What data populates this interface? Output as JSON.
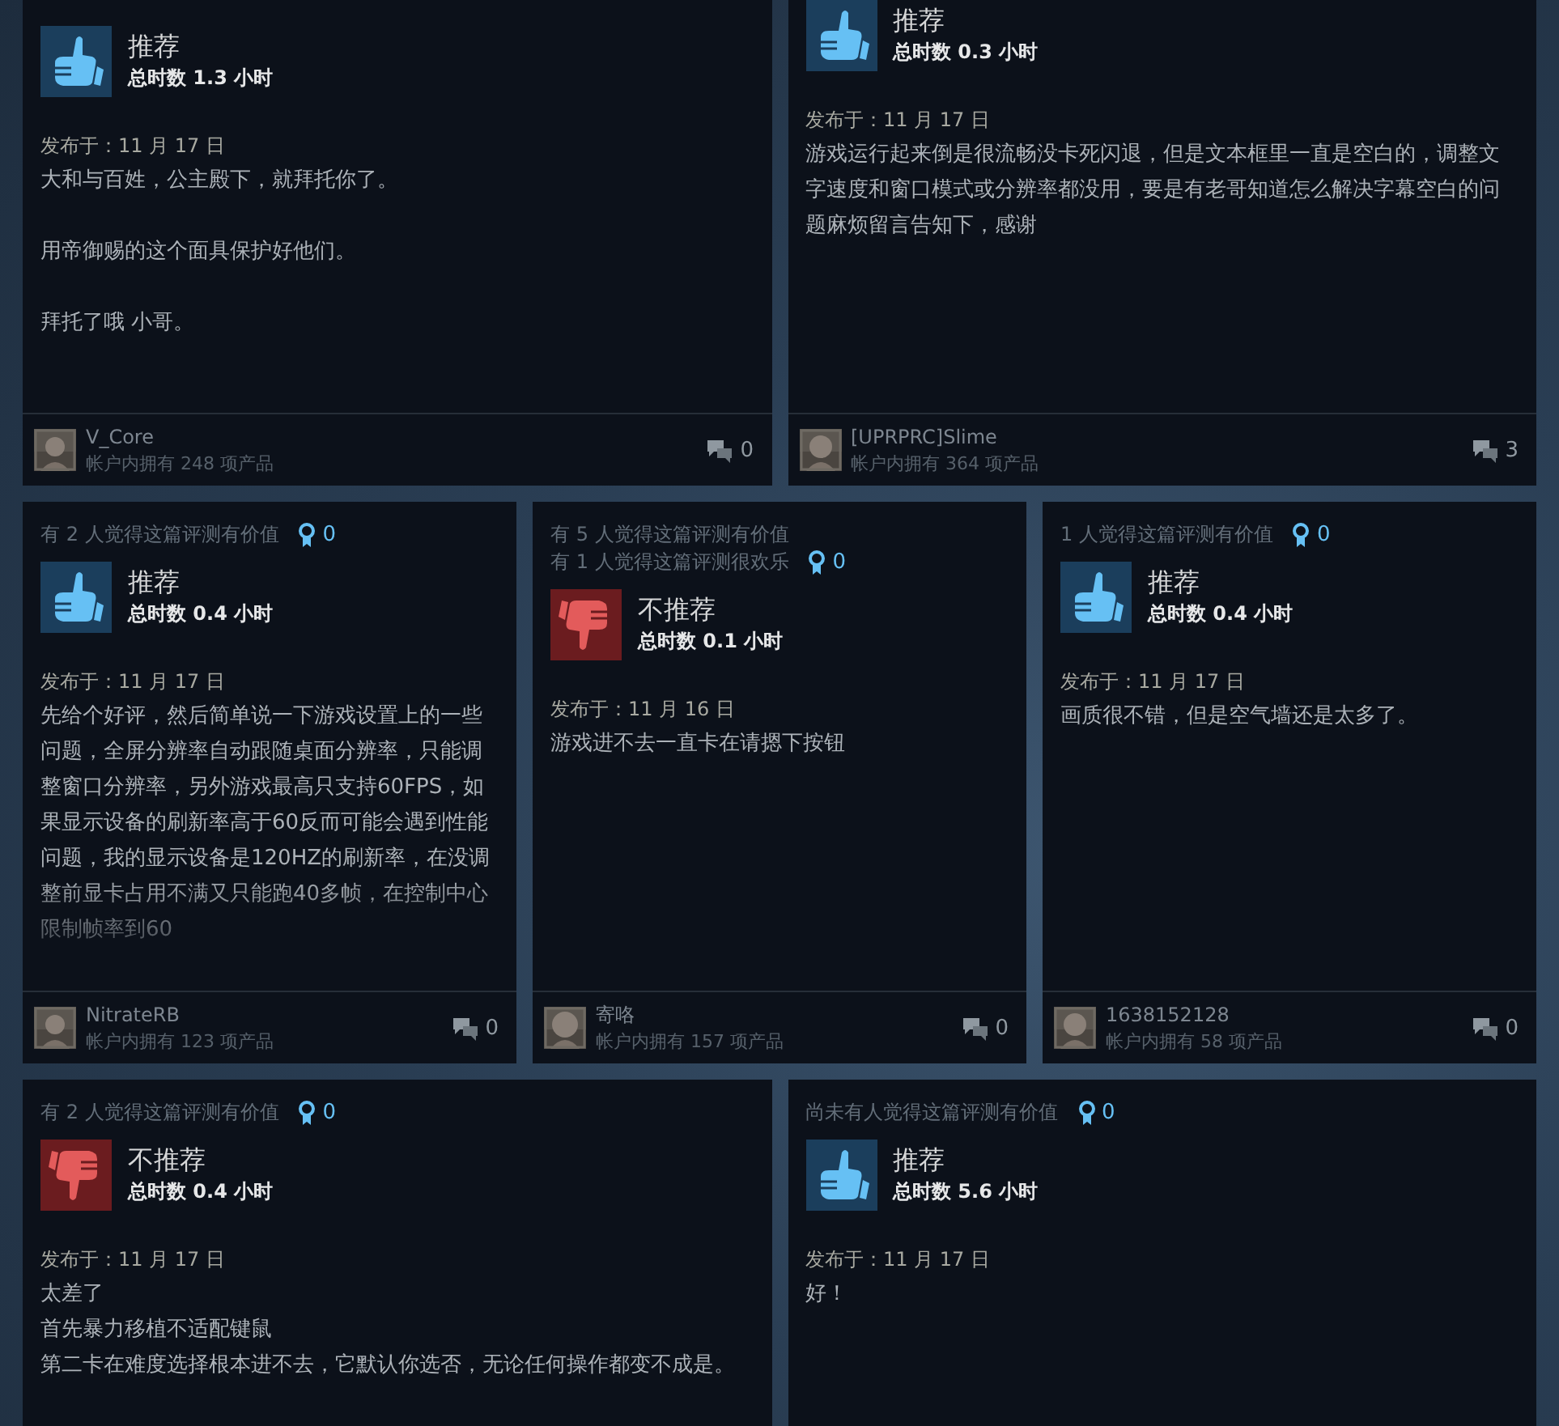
{
  "rows": [
    {
      "reviews": [
        {
          "verdict": {
            "kind": "up",
            "label": "推荐"
          },
          "hours": "总时数 1.3 小时",
          "posted": "发布于：11 月 17 日",
          "body": [
            {
              "kind": "paragraph",
              "text": "大和与百姓，公主殿下，就拜托你了。"
            },
            {
              "kind": "paragraph",
              "text": "用帝御赐的这个面具保护好他们。"
            },
            {
              "kind": "paragraph",
              "text": "拜托了哦 小哥。"
            }
          ],
          "author": "V_Core",
          "products": "帐户内拥有 248 项产品",
          "comments": "0"
        },
        {
          "verdict": {
            "kind": "up",
            "label": "推荐"
          },
          "hours": "总时数 0.3 小时",
          "posted": "发布于：11 月 17 日",
          "body": [
            {
              "kind": "line",
              "text": "游戏运行起来倒是很流畅没卡死闪退，但是文本框里一直是空白的，调整文字速度和窗口模式或分辨率都没用，要是有老哥知道怎么解决字幕空白的问题麻烦留言告知下，感谢"
            }
          ],
          "author": "[UPRPRC]Slime",
          "products": "帐户内拥有 364 项产品",
          "comments": "3"
        }
      ]
    },
    {
      "reviews": [
        {
          "helpful": [
            "有 2 人觉得这篇评测有价值"
          ],
          "award_count": "0",
          "verdict": {
            "kind": "up",
            "label": "推荐"
          },
          "hours": "总时数 0.4 小时",
          "posted": "发布于：11 月 17 日",
          "truncated": true,
          "body": [
            {
              "kind": "line",
              "text": "先给个好评，然后简单说一下游戏设置上的一些问题，全屏分辨率自动跟随桌面分辨率，只能调整窗口分辨率，另外游戏最高只支持60FPS，如果显示设备的刷新率高于60反而可能会遇到性能问题，我的显示设备是120HZ的刷新率，在没调整前显卡占用不满又只能跑40多帧，在控制中心限制帧率到60"
            }
          ],
          "author": "NitrateRB",
          "products": "帐户内拥有 123 项产品",
          "comments": "0"
        },
        {
          "helpful": [
            "有 5 人觉得这篇评测有价值",
            "有 1 人觉得这篇评测很欢乐"
          ],
          "award_count": "0",
          "verdict": {
            "kind": "down",
            "label": "不推荐"
          },
          "hours": "总时数 0.1 小时",
          "posted": "发布于：11 月 16 日",
          "body": [
            {
              "kind": "line",
              "text": "游戏进不去一直卡在请摁下按钮"
            }
          ],
          "author": "寄咯",
          "products": "帐户内拥有 157 项产品",
          "comments": "0"
        },
        {
          "helpful": [
            "1 人觉得这篇评测有价值"
          ],
          "award_count": "0",
          "verdict": {
            "kind": "up",
            "label": "推荐"
          },
          "hours": "总时数 0.4 小时",
          "posted": "发布于：11 月 17 日",
          "body": [
            {
              "kind": "line",
              "text": "画质很不错，但是空气墙还是太多了。"
            }
          ],
          "author": "1638152128",
          "products": "帐户内拥有 58 项产品",
          "comments": "0"
        }
      ]
    },
    {
      "reviews": [
        {
          "helpful": [
            "有 2 人觉得这篇评测有价值"
          ],
          "award_count": "0",
          "verdict": {
            "kind": "down",
            "label": "不推荐"
          },
          "hours": "总时数 0.4 小时",
          "posted": "发布于：11 月 17 日",
          "body": [
            {
              "kind": "line",
              "text": "太差了"
            },
            {
              "kind": "line",
              "text": "首先暴力移植不适配键鼠"
            },
            {
              "kind": "line",
              "text": "第二卡在难度选择根本进不去，它默认你选否，无论任何操作都变不成是。"
            }
          ]
        },
        {
          "helpful": [
            "尚未有人觉得这篇评测有价值"
          ],
          "award_count": "0",
          "verdict": {
            "kind": "up",
            "label": "推荐"
          },
          "hours": "总时数 5.6 小时",
          "posted": "发布于：11 月 17 日",
          "body": [
            {
              "kind": "line",
              "text": "好！"
            }
          ]
        }
      ]
    }
  ]
}
